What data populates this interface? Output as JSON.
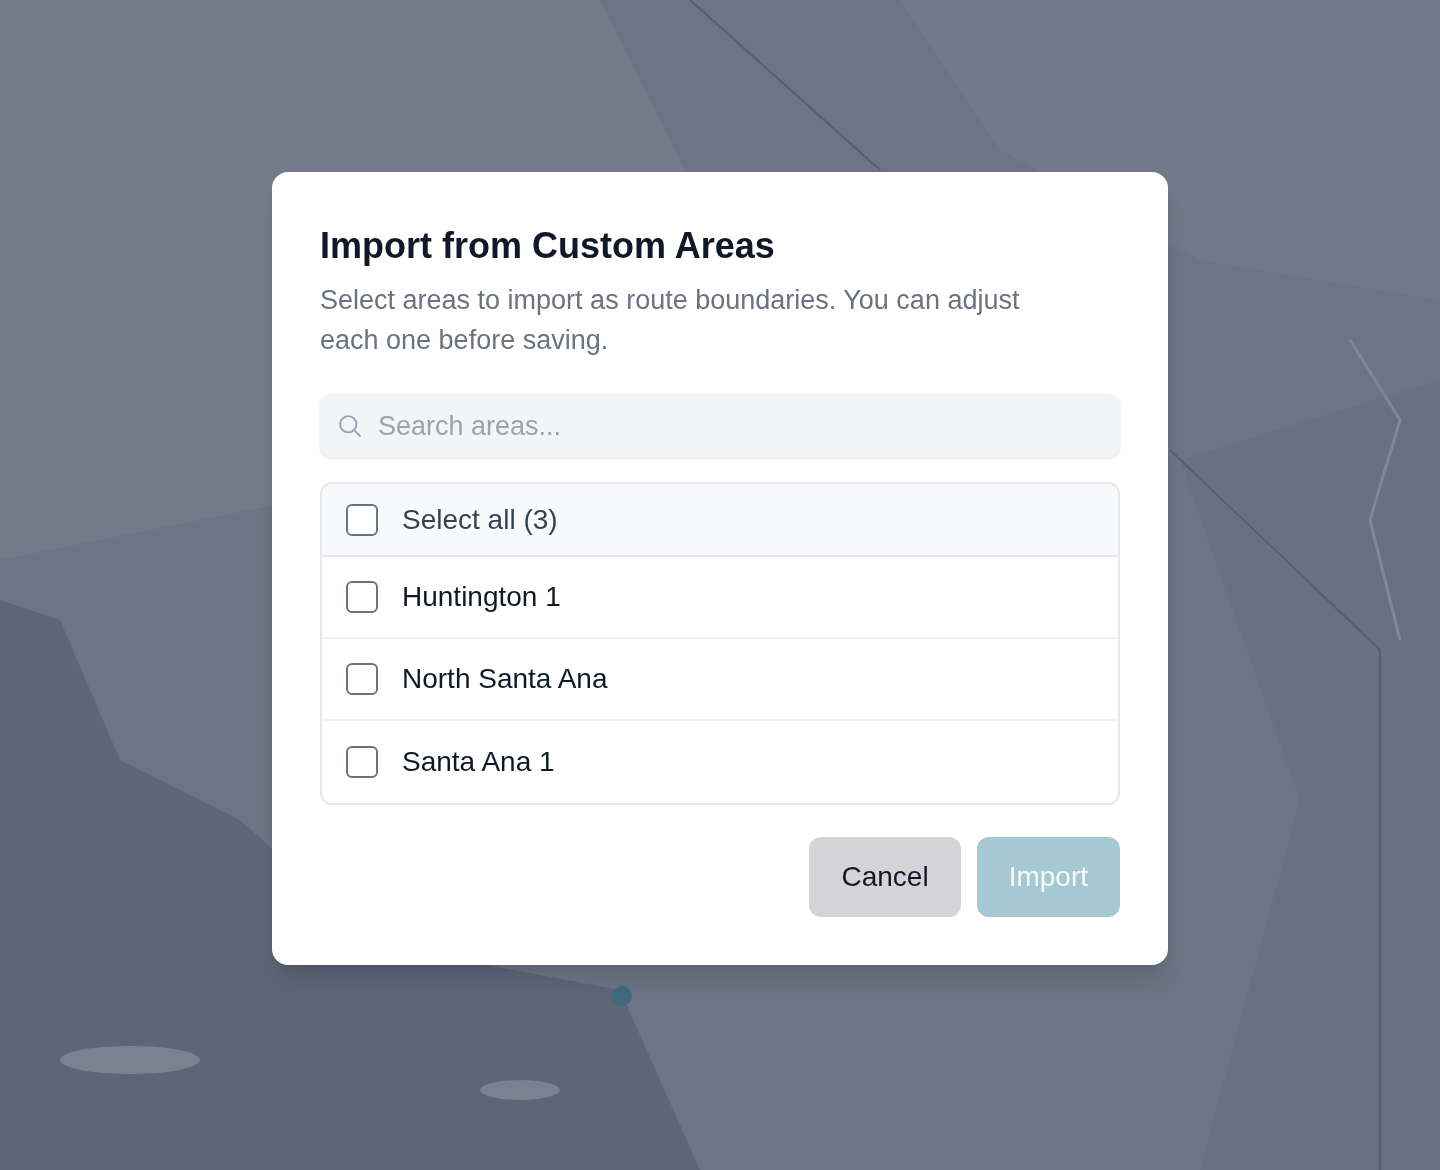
{
  "dialog": {
    "title": "Import from Custom Areas",
    "description": "Select areas to import as route boundaries. You can adjust each one before saving.",
    "search": {
      "placeholder": "Search areas..."
    },
    "select_all": {
      "label": "Select all (3)",
      "checked": false
    },
    "areas": [
      {
        "label": "Huntington 1",
        "checked": false
      },
      {
        "label": "North Santa Ana",
        "checked": false
      },
      {
        "label": "Santa Ana 1",
        "checked": false
      }
    ],
    "buttons": [
      {
        "label": "Cancel",
        "kind": "secondary",
        "disabled": false
      },
      {
        "label": "Import",
        "kind": "primary",
        "disabled": true
      }
    ]
  }
}
